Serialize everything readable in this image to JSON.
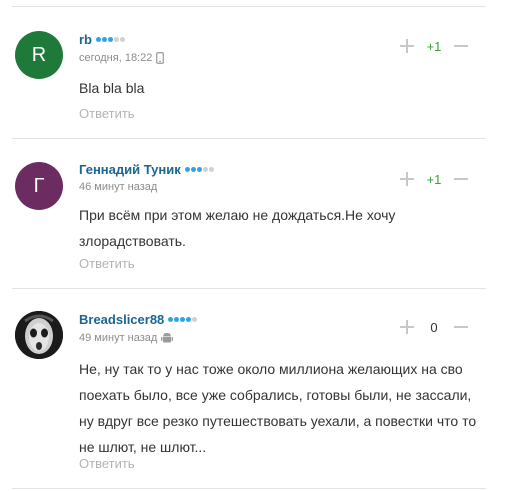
{
  "comments": [
    {
      "avatar_letter": "R",
      "avatar_color": "#1f7a3a",
      "author": "rb",
      "rating_dots": [
        true,
        true,
        true,
        false,
        false
      ],
      "time": "сегодня, 18:22",
      "device": "phone-icon",
      "text": "Bla bla bla",
      "reply_label": "Ответить",
      "score": "+1"
    },
    {
      "avatar_letter": "Г",
      "avatar_color": "#6c2c62",
      "author": "Геннадий Туник",
      "rating_dots": [
        true,
        true,
        true,
        false,
        false
      ],
      "time": "46 минут назад",
      "device": "",
      "text": "При всём при этом желаю не дождаться.Не хочу злорадствовать.",
      "reply_label": "Ответить",
      "score": "+1"
    },
    {
      "avatar_letter": "",
      "avatar_color": "#2a2a2a",
      "author": "Breadslicer88",
      "rating_dots": [
        true,
        true,
        true,
        true,
        false
      ],
      "time": "49 минут назад",
      "device": "android-icon",
      "text": "Не, ну так то у нас тоже около миллиона желающих на сво поехать было, все уже собрались, готовы были, не зассали, ну вдруг все резко путешествовать уехали, а повестки что то не шлют, не шлют...",
      "reply_label": "Ответить",
      "score": "0"
    }
  ],
  "colors": {
    "link": "#1a6690",
    "rating_on": "#2ea4e6",
    "score_positive": "#3aa335",
    "muted": "#b3b3b3"
  }
}
